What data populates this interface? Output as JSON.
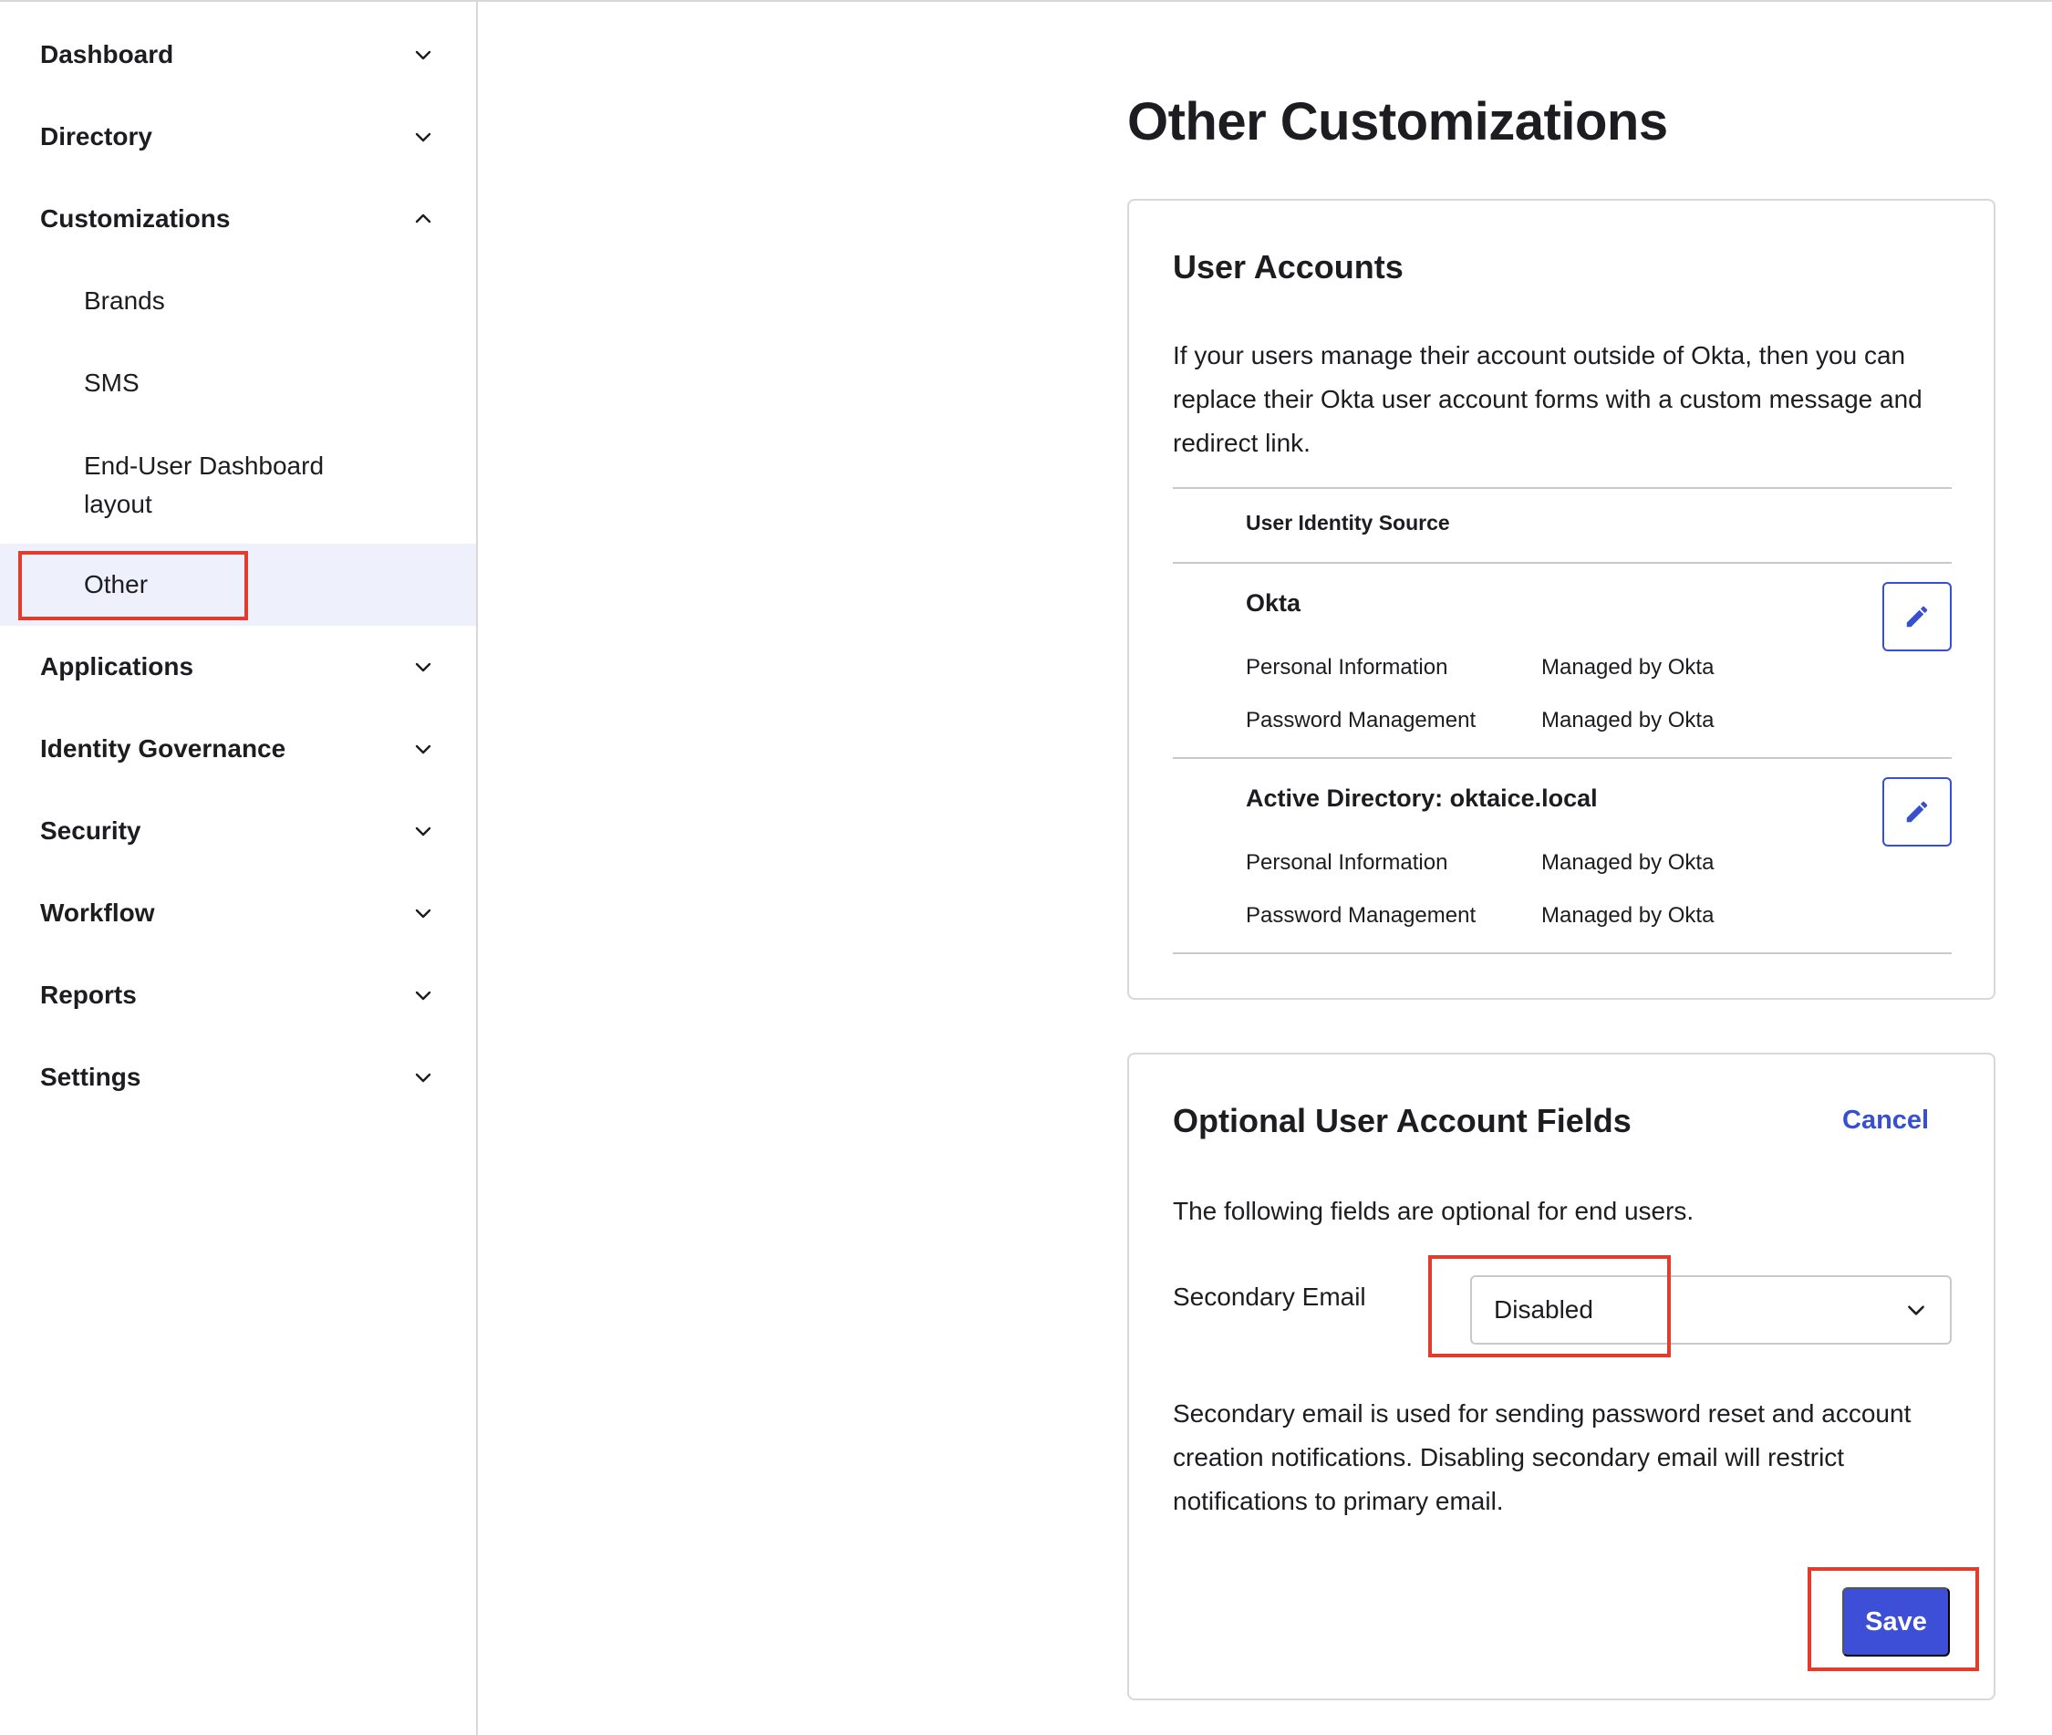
{
  "sidebar": {
    "items": [
      {
        "label": "Dashboard",
        "expanded": false
      },
      {
        "label": "Directory",
        "expanded": false
      },
      {
        "label": "Customizations",
        "expanded": true
      },
      {
        "label": "Applications",
        "expanded": false
      },
      {
        "label": "Identity Governance",
        "expanded": false
      },
      {
        "label": "Security",
        "expanded": false
      },
      {
        "label": "Workflow",
        "expanded": false
      },
      {
        "label": "Reports",
        "expanded": false
      },
      {
        "label": "Settings",
        "expanded": false
      }
    ],
    "customizations_children": [
      {
        "label": "Brands"
      },
      {
        "label": "SMS"
      },
      {
        "label": "End-User Dashboard layout"
      },
      {
        "label": "Other",
        "active": true
      }
    ]
  },
  "main": {
    "title": "Other Customizations",
    "user_accounts": {
      "title": "User Accounts",
      "description": "If your users manage their account outside of Okta, then you can replace their Okta user account forms with a custom message and redirect link.",
      "table_header": "User Identity Source",
      "sources": [
        {
          "name": "Okta",
          "rows": [
            {
              "key": "Personal Information",
              "value": "Managed by Okta"
            },
            {
              "key": "Password Management",
              "value": "Managed by Okta"
            }
          ]
        },
        {
          "name": "Active Directory: oktaice.local",
          "rows": [
            {
              "key": "Personal Information",
              "value": "Managed by Okta"
            },
            {
              "key": "Password Management",
              "value": "Managed by Okta"
            }
          ]
        }
      ]
    },
    "optional_fields": {
      "title": "Optional User Account Fields",
      "cancel_label": "Cancel",
      "description": "The following fields are optional for end users.",
      "secondary_email_label": "Secondary Email",
      "secondary_email_value": "Disabled",
      "help_text": "Secondary email is used for sending password reset and account creation notifications. Disabling secondary email will restrict notifications to primary email.",
      "save_label": "Save"
    }
  },
  "colors": {
    "accent": "#3d4fd6",
    "link": "#3650cf",
    "active_bg": "#eef0fc",
    "highlight_box": "#e23d2c"
  },
  "icons": {
    "collapsed": "chevron-down-icon",
    "expanded": "chevron-up-icon",
    "edit": "pencil-icon",
    "select": "chevron-down-icon"
  }
}
